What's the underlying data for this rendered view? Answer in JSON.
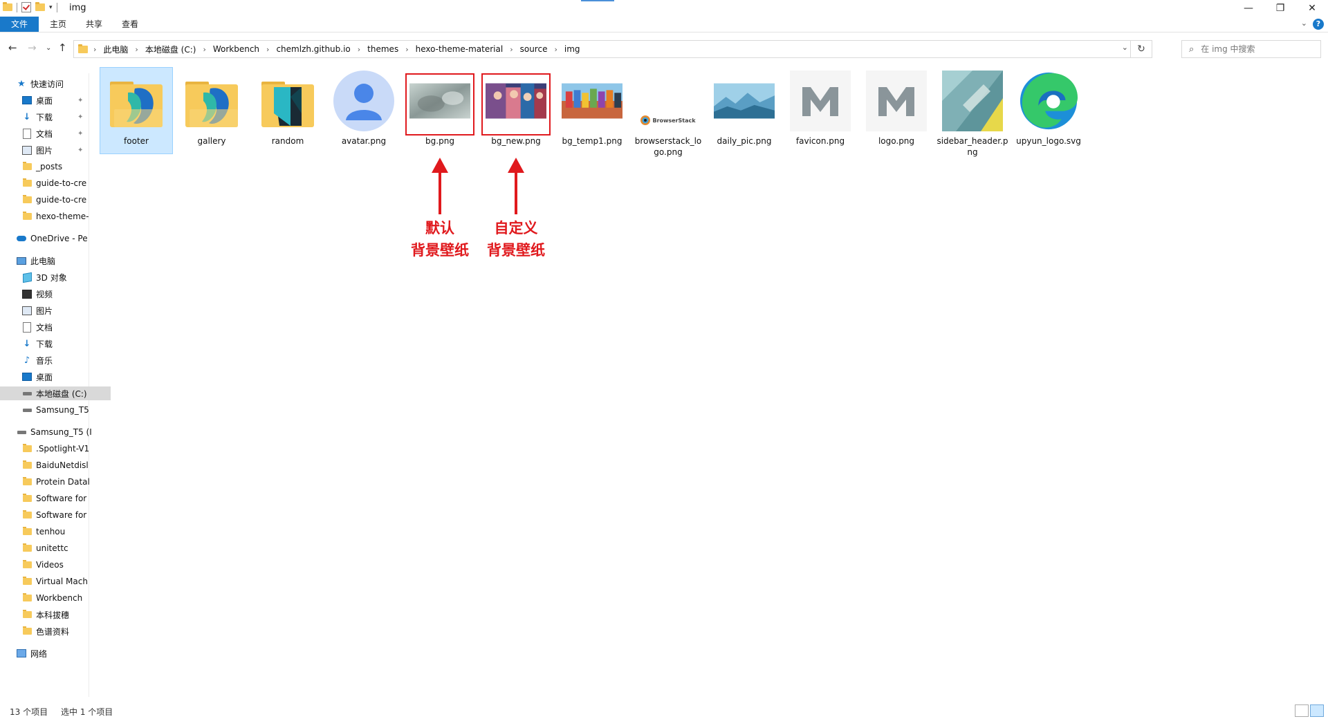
{
  "window": {
    "title": "img"
  },
  "ribbon": {
    "tabs": [
      "文件",
      "主页",
      "共享",
      "查看"
    ]
  },
  "address": {
    "crumbs": [
      "此电脑",
      "本地磁盘 (C:)",
      "Workbench",
      "chemlzh.github.io",
      "themes",
      "hexo-theme-material",
      "source",
      "img"
    ]
  },
  "search": {
    "placeholder": "在 img 中搜索"
  },
  "sidebar": {
    "items": [
      {
        "label": "快速访问",
        "icon": "star-icon"
      },
      {
        "label": "桌面",
        "icon": "desktop-icon",
        "pinned": true
      },
      {
        "label": "下载",
        "icon": "download-icon",
        "pinned": true
      },
      {
        "label": "文档",
        "icon": "document-icon",
        "pinned": true
      },
      {
        "label": "图片",
        "icon": "picture-icon",
        "pinned": true
      },
      {
        "label": "_posts",
        "icon": "folder-icon"
      },
      {
        "label": "guide-to-cre",
        "icon": "folder-icon"
      },
      {
        "label": "guide-to-cre",
        "icon": "folder-icon"
      },
      {
        "label": "hexo-theme-",
        "icon": "folder-icon"
      },
      {
        "label": "OneDrive - Pe",
        "icon": "cloud-icon"
      },
      {
        "label": "此电脑",
        "icon": "computer-icon"
      },
      {
        "label": "3D 对象",
        "icon": "3d-object-icon"
      },
      {
        "label": "视频",
        "icon": "video-icon"
      },
      {
        "label": "图片",
        "icon": "picture-icon"
      },
      {
        "label": "文档",
        "icon": "document-icon"
      },
      {
        "label": "下载",
        "icon": "download-icon"
      },
      {
        "label": "音乐",
        "icon": "music-icon"
      },
      {
        "label": "桌面",
        "icon": "desktop-icon"
      },
      {
        "label": "本地磁盘 (C:)",
        "icon": "drive-icon",
        "selected": true
      },
      {
        "label": "Samsung_T5",
        "icon": "drive-icon"
      },
      {
        "label": "Samsung_T5 (I",
        "icon": "drive-icon"
      },
      {
        "label": ".Spotlight-V1",
        "icon": "folder-icon"
      },
      {
        "label": "BaiduNetdisl",
        "icon": "folder-icon"
      },
      {
        "label": "Protein Datal",
        "icon": "folder-icon"
      },
      {
        "label": "Software for",
        "icon": "folder-icon"
      },
      {
        "label": "Software for",
        "icon": "folder-icon"
      },
      {
        "label": "tenhou",
        "icon": "folder-icon"
      },
      {
        "label": "unitettc",
        "icon": "folder-icon"
      },
      {
        "label": "Videos",
        "icon": "folder-icon"
      },
      {
        "label": "Virtual Mach",
        "icon": "folder-icon"
      },
      {
        "label": "Workbench",
        "icon": "folder-icon"
      },
      {
        "label": "本科拔穗",
        "icon": "folder-icon"
      },
      {
        "label": "色谱资料",
        "icon": "folder-icon"
      },
      {
        "label": "网络",
        "icon": "network-icon"
      }
    ]
  },
  "files": [
    {
      "name": "footer",
      "kind": "folder",
      "selected": true
    },
    {
      "name": "gallery",
      "kind": "folder"
    },
    {
      "name": "random",
      "kind": "folder"
    },
    {
      "name": "avatar.png",
      "kind": "avatar"
    },
    {
      "name": "bg.png",
      "kind": "blur",
      "highlight": true
    },
    {
      "name": "bg_new.png",
      "kind": "anime",
      "highlight": true
    },
    {
      "name": "bg_temp1.png",
      "kind": "crowd"
    },
    {
      "name": "browserstack_logo.png",
      "kind": "browserstack",
      "logo_text": "BrowserStack"
    },
    {
      "name": "daily_pic.png",
      "kind": "landscape"
    },
    {
      "name": "favicon.png",
      "kind": "m-logo"
    },
    {
      "name": "logo.png",
      "kind": "m-logo"
    },
    {
      "name": "sidebar_header.png",
      "kind": "material"
    },
    {
      "name": "upyun_logo.svg",
      "kind": "edge"
    }
  ],
  "annotations": [
    {
      "line1": "默认",
      "line2": "背景壁纸"
    },
    {
      "line1": "自定义",
      "line2": "背景壁纸"
    }
  ],
  "status": {
    "count": "13 个项目",
    "selected": "选中 1 个项目"
  },
  "colors": {
    "accent": "#1979ca",
    "annotation": "#e0191d",
    "folder": "#f7ca5b",
    "selection": "#cce8ff"
  }
}
